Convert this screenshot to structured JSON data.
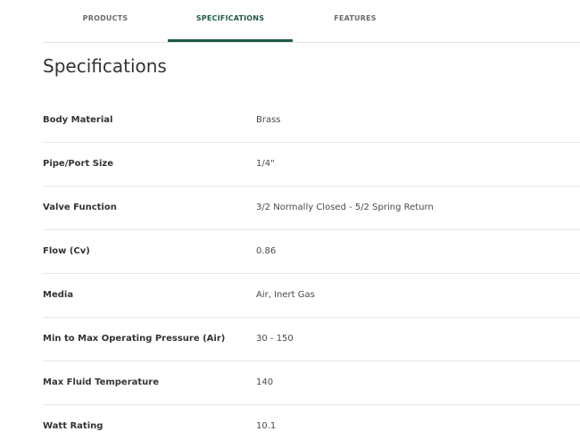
{
  "tabs": [
    {
      "label": "PRODUCTS",
      "active": false
    },
    {
      "label": "SPECIFICATIONS",
      "active": true
    },
    {
      "label": "FEATURES",
      "active": false
    }
  ],
  "accent_color": "#1f5a49",
  "section": {
    "title": "Specifications"
  },
  "specs": [
    {
      "label": "Body Material",
      "value": "Brass"
    },
    {
      "label": "Pipe/Port Size",
      "value": "1/4\""
    },
    {
      "label": "Valve Function",
      "value": "3/2 Normally Closed - 5/2 Spring Return"
    },
    {
      "label": "Flow (Cv)",
      "value": "0.86"
    },
    {
      "label": "Media",
      "value": "Air, Inert Gas"
    },
    {
      "label": "Min to Max Operating Pressure (Air)",
      "value": "30 - 150"
    },
    {
      "label": "Max Fluid Temperature",
      "value": "140"
    },
    {
      "label": "Watt Rating",
      "value": "10.1"
    }
  ]
}
